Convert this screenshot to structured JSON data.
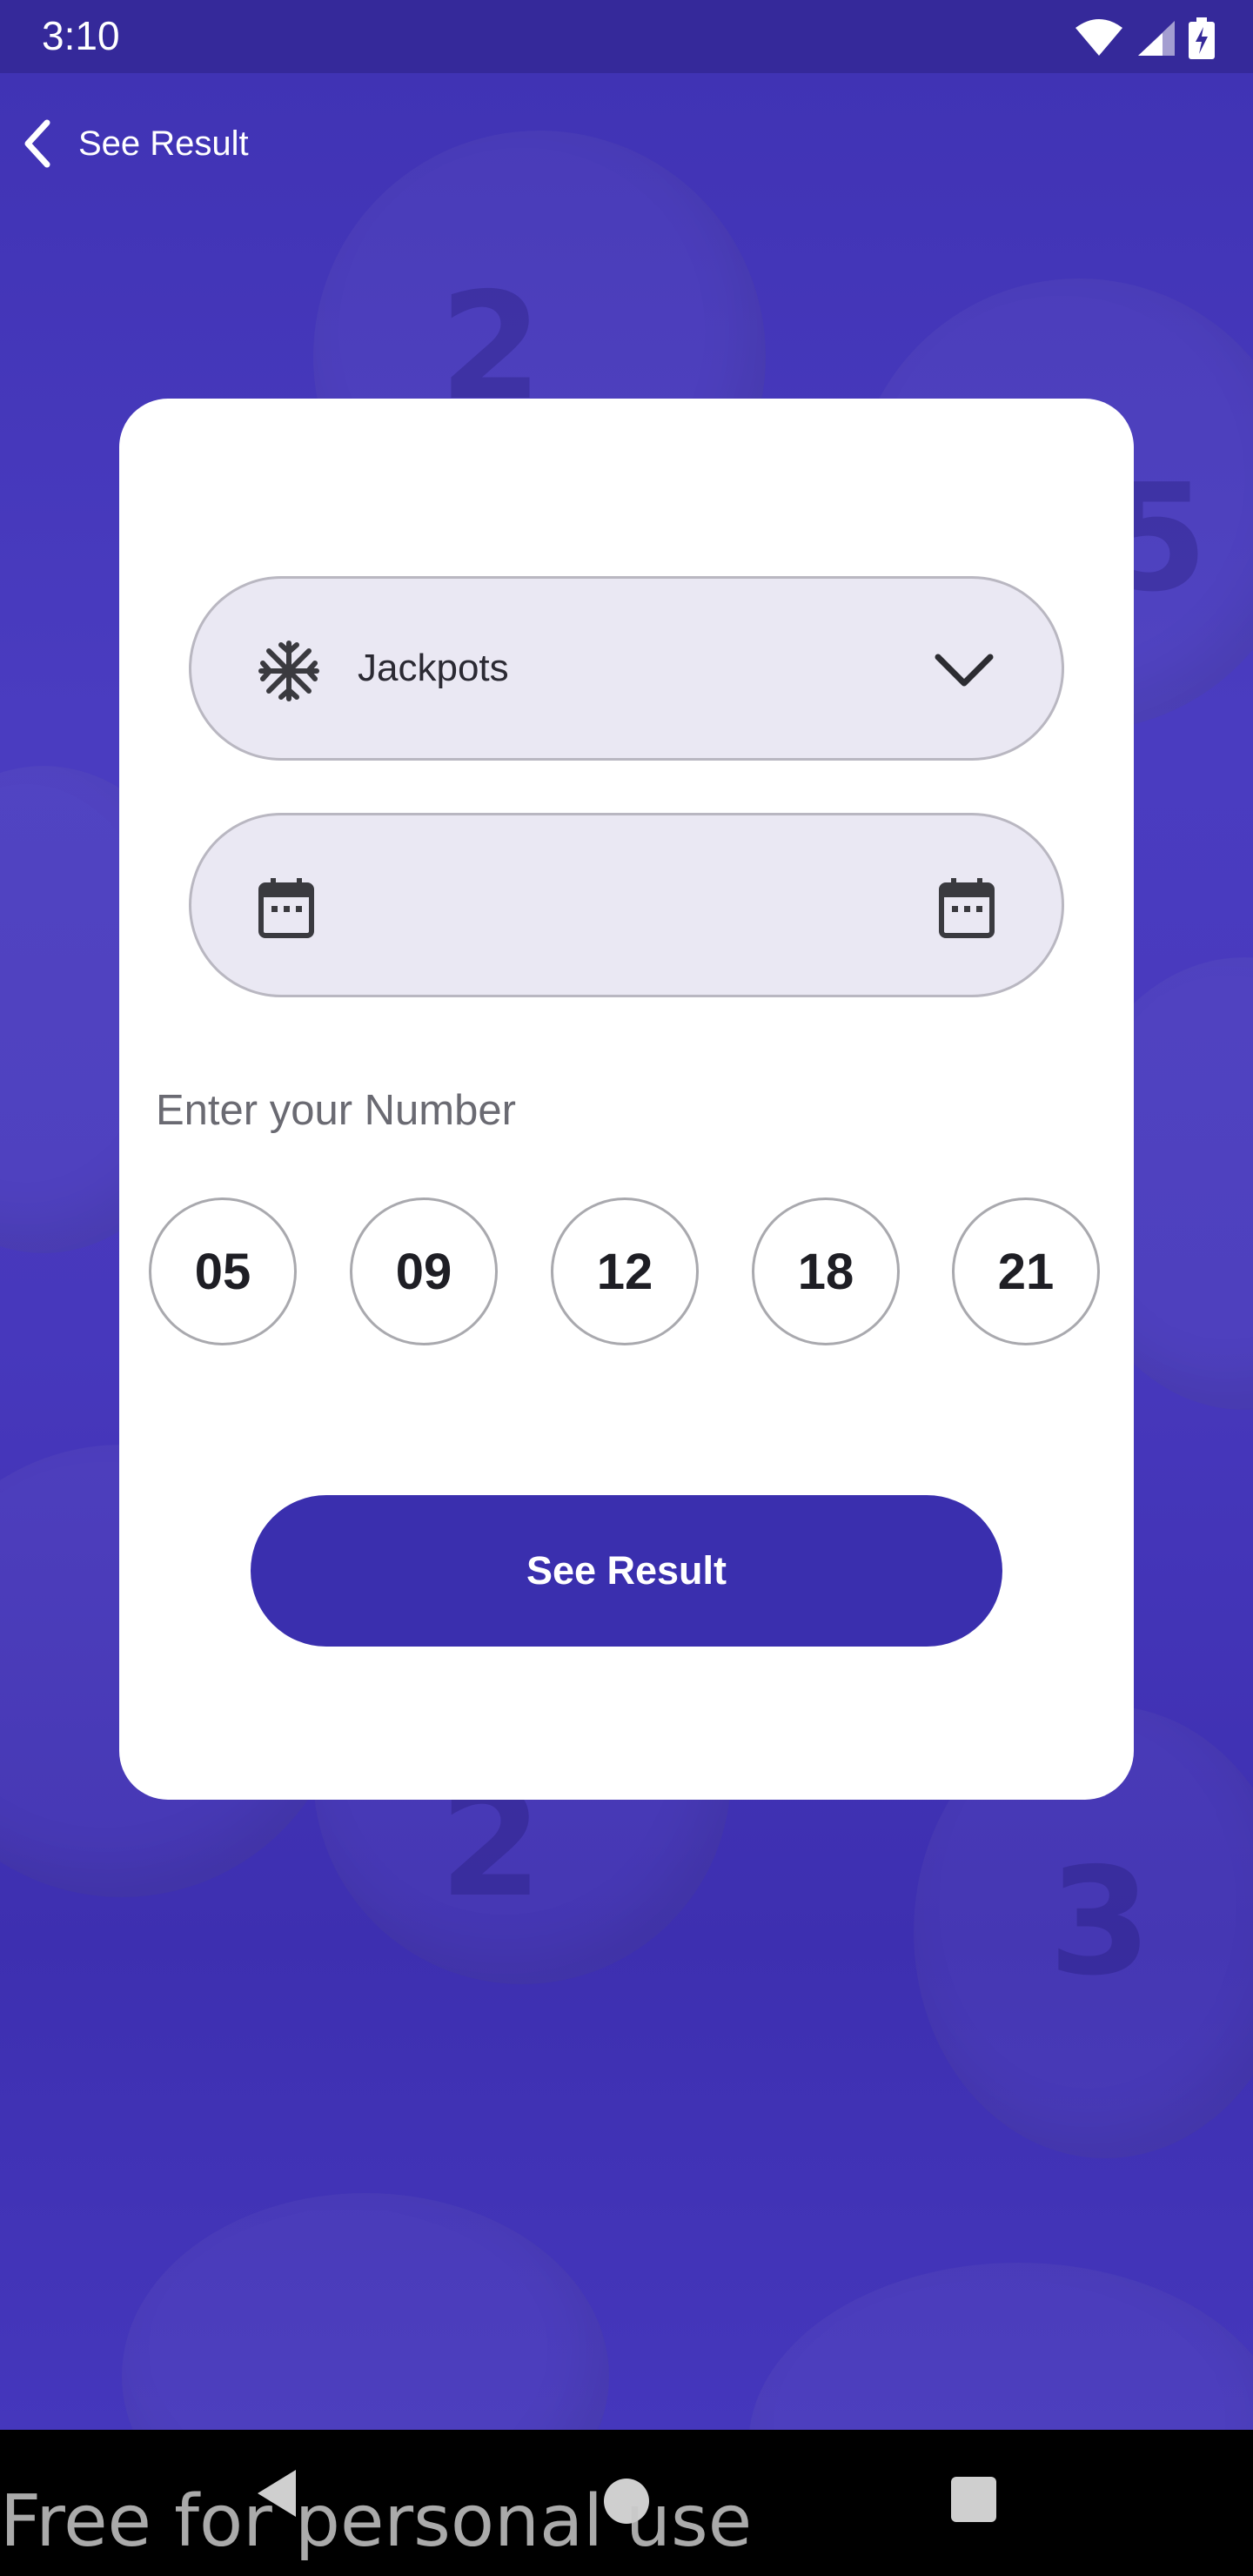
{
  "status_bar": {
    "time": "3:10",
    "icons": [
      "wifi-icon",
      "signal-icon",
      "battery-charging-icon"
    ]
  },
  "app_bar": {
    "title": "See Result",
    "back_icon": "chevron-left-icon"
  },
  "background": {
    "decor_numbers": [
      "2",
      "5",
      "2",
      "3"
    ]
  },
  "form": {
    "category": {
      "icon": "snowflake-icon",
      "selected": "Jackpots",
      "dropdown_icon": "chevron-down-icon"
    },
    "date": {
      "icon_left": "calendar-icon",
      "value": "",
      "icon_right": "calendar-icon"
    },
    "numbers_label": "Enter your Number",
    "numbers": [
      "05",
      "09",
      "12",
      "18",
      "21"
    ],
    "submit_label": "See Result"
  },
  "nav_bar": {
    "buttons": [
      "back",
      "home",
      "recents"
    ]
  },
  "watermark": "Free for personal use",
  "colors": {
    "primary": "#3a2fae",
    "status_bar": "#35299a",
    "field_bg": "#eae8f3",
    "card_bg": "#ffffff"
  }
}
